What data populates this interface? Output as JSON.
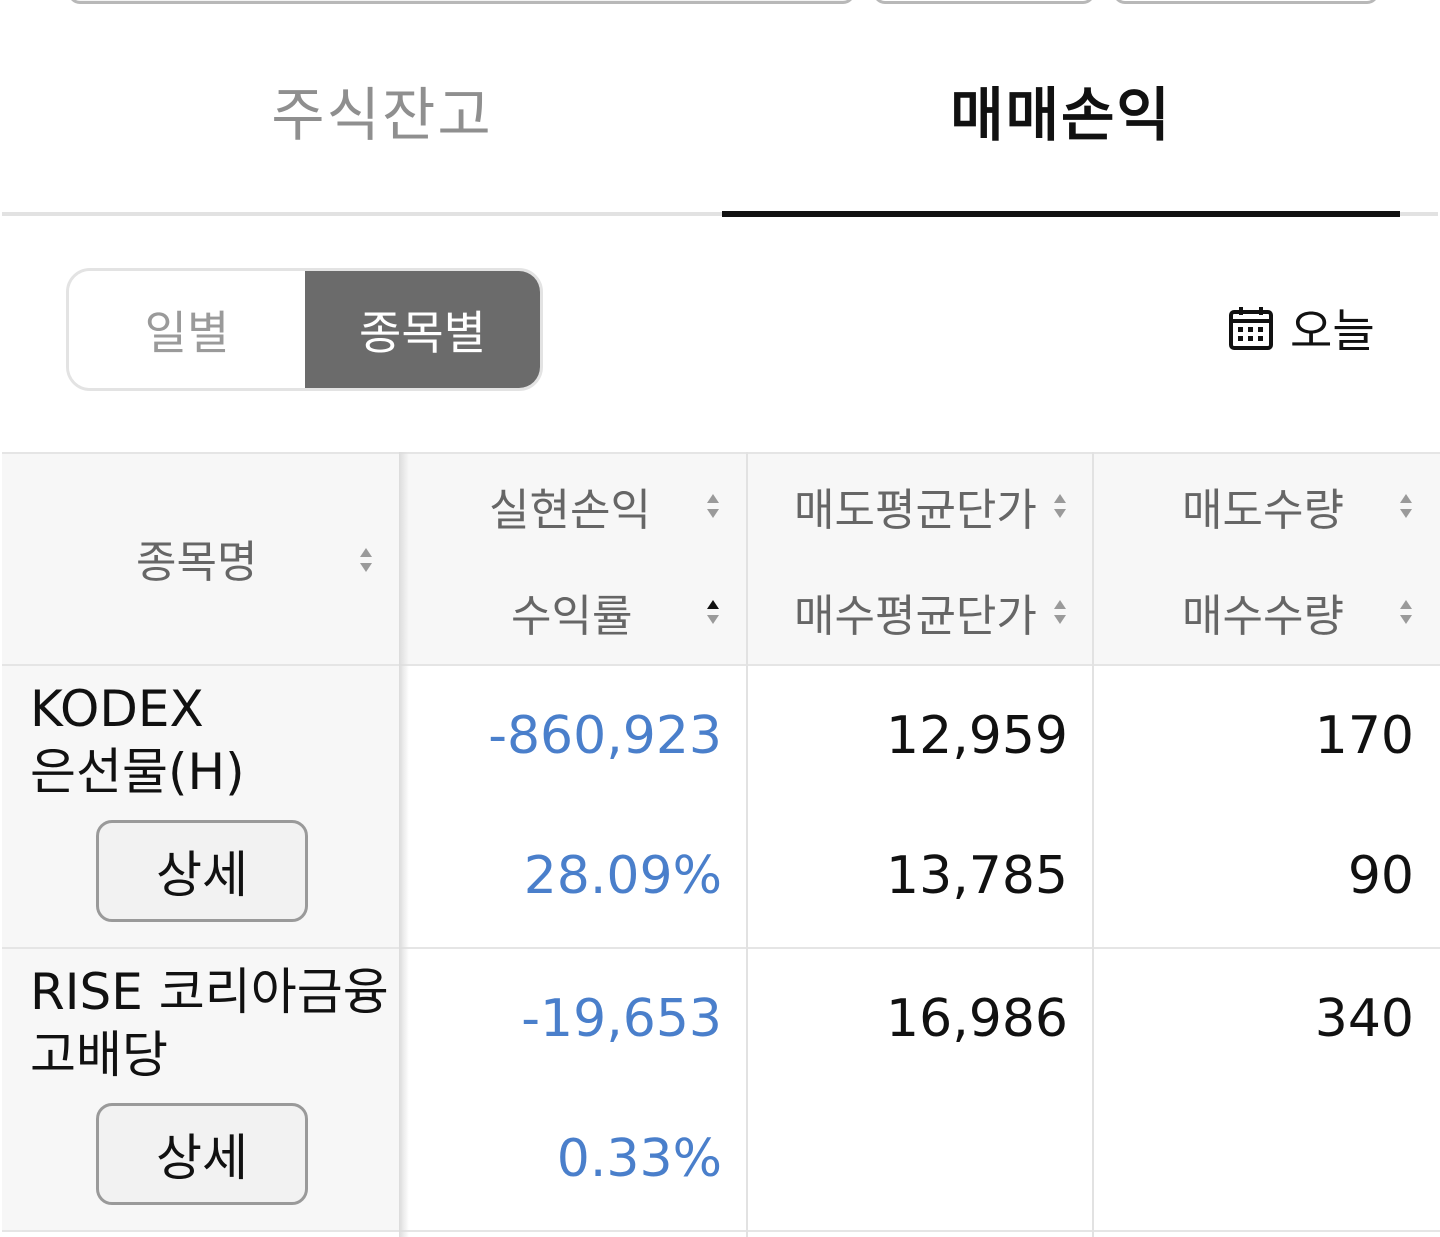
{
  "tabs": [
    {
      "label": "주식잔고",
      "active": false
    },
    {
      "label": "매매손익",
      "active": true
    }
  ],
  "segment": {
    "daily": "일별",
    "by_item": "종목별",
    "selected": "종목별"
  },
  "date_filter": {
    "icon": "calendar-icon",
    "label": "오늘"
  },
  "table": {
    "headers": {
      "name": "종목명",
      "realized_pl": "실현손익",
      "return_rate": "수익률",
      "sell_avg_price": "매도평균단가",
      "buy_avg_price": "매수평균단가",
      "sell_qty": "매도수량",
      "buy_qty": "매수수량"
    },
    "rows": [
      {
        "name_line1": "KODEX",
        "name_line2": "은선물(H)",
        "detail": "상세",
        "realized_pl": "-860,923",
        "return_rate": "28.09%",
        "sell_avg_price": "12,959",
        "buy_avg_price": "13,785",
        "sell_qty": "170",
        "buy_qty": "90"
      },
      {
        "name_line1": "RISE 코리아금융",
        "name_line2": "고배당",
        "detail": "상세",
        "realized_pl": "-19,653",
        "return_rate": "0.33%",
        "sell_avg_price": "16,986",
        "buy_avg_price": "",
        "sell_qty": "340",
        "buy_qty": ""
      }
    ]
  },
  "colors": {
    "loss_blue": "#4a7fcb",
    "segment_active_bg": "#6b6b6b",
    "tab_active": "#111111",
    "tab_inactive": "#8f8f8f"
  }
}
